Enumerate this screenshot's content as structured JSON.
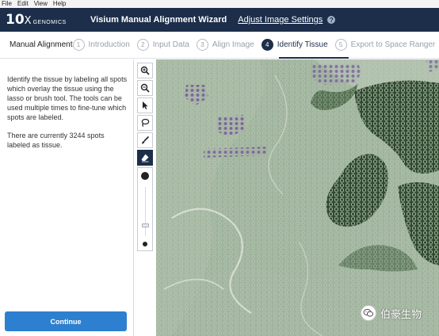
{
  "menu": [
    "File",
    "Edit",
    "View",
    "Help"
  ],
  "header": {
    "logo_number": "10",
    "logo_x": "X",
    "logo_word": "GENOMICS",
    "title": "Visium Manual Alignment Wizard",
    "adjust_link": "Adjust Image Settings",
    "help_icon": "question-circle-icon"
  },
  "stepbar": {
    "mode": "Manual Alignment",
    "steps": [
      {
        "num": "1",
        "label": "Introduction",
        "active": false
      },
      {
        "num": "2",
        "label": "Input Data",
        "active": false
      },
      {
        "num": "3",
        "label": "Align Image",
        "active": false
      },
      {
        "num": "4",
        "label": "Identify Tissue",
        "active": true
      },
      {
        "num": "5",
        "label": "Export to Space Ranger",
        "active": false
      }
    ]
  },
  "left": {
    "instructions": "Identify the tissue by labeling all spots which overlay the tissue using the lasso or brush tool. The tools can be used multiple times to fine-tune which spots are labeled.",
    "count_text": "There are currently 3244 spots labeled as tissue.",
    "continue": "Continue"
  },
  "toolbar": {
    "tools": [
      "zoom-in-icon",
      "zoom-out-icon",
      "pointer-icon",
      "lasso-icon",
      "brush-icon",
      "eraser-icon"
    ],
    "active_tool": "eraser-icon"
  },
  "viewport": {
    "tissue_color": "#9fb49c",
    "dark_region_color": "#2f4a2e",
    "selected_spot_color": "#7a6a9a"
  },
  "watermark": {
    "icon": "wechat-icon",
    "text": "伯豪生物"
  }
}
